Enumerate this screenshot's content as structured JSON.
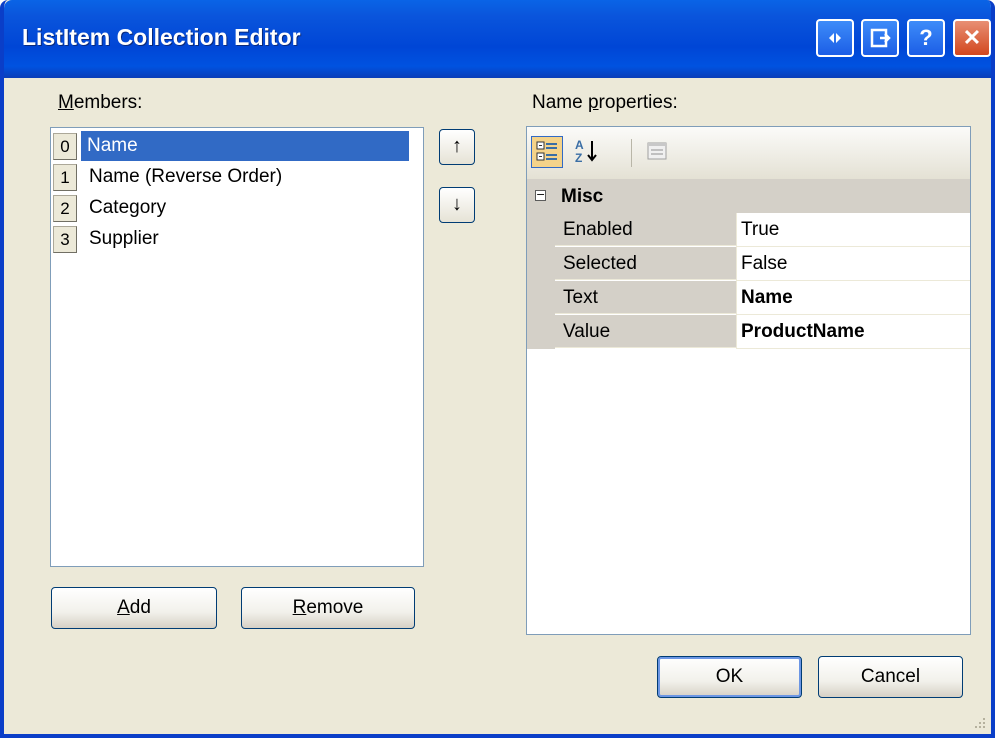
{
  "window": {
    "title": "ListItem Collection Editor",
    "buttons": {
      "help": "?",
      "close": "✕"
    }
  },
  "members": {
    "label_underlined": "M",
    "label_rest": "embers:",
    "items": [
      {
        "index": "0",
        "text": "Name",
        "selected": true
      },
      {
        "index": "1",
        "text": "Name (Reverse Order)"
      },
      {
        "index": "2",
        "text": "Category"
      },
      {
        "index": "3",
        "text": "Supplier"
      }
    ],
    "up_icon": "↑",
    "down_icon": "↓"
  },
  "buttons": {
    "add_underlined": "A",
    "add_rest": "dd",
    "remove_underlined": "R",
    "remove_rest": "emove",
    "ok": "OK",
    "cancel": "Cancel"
  },
  "properties": {
    "label_before": "Name ",
    "label_underlined": "p",
    "label_after": "roperties:",
    "toolbar": {
      "categorized_icon": "categorized-icon",
      "alphabetical_icon": "alphabetical-icon",
      "property_pages_icon": "property-pages-icon"
    },
    "category": {
      "toggle": "−",
      "name": "Misc"
    },
    "rows": [
      {
        "name": "Enabled",
        "value": "True"
      },
      {
        "name": "Selected",
        "value": "False"
      },
      {
        "name": "Text",
        "value": "Name"
      },
      {
        "name": "Value",
        "value": "ProductName"
      }
    ]
  },
  "colors": {
    "title_bar": "#0054E3",
    "selection": "#316AC5",
    "dialog_bg": "#ECE9D8"
  }
}
